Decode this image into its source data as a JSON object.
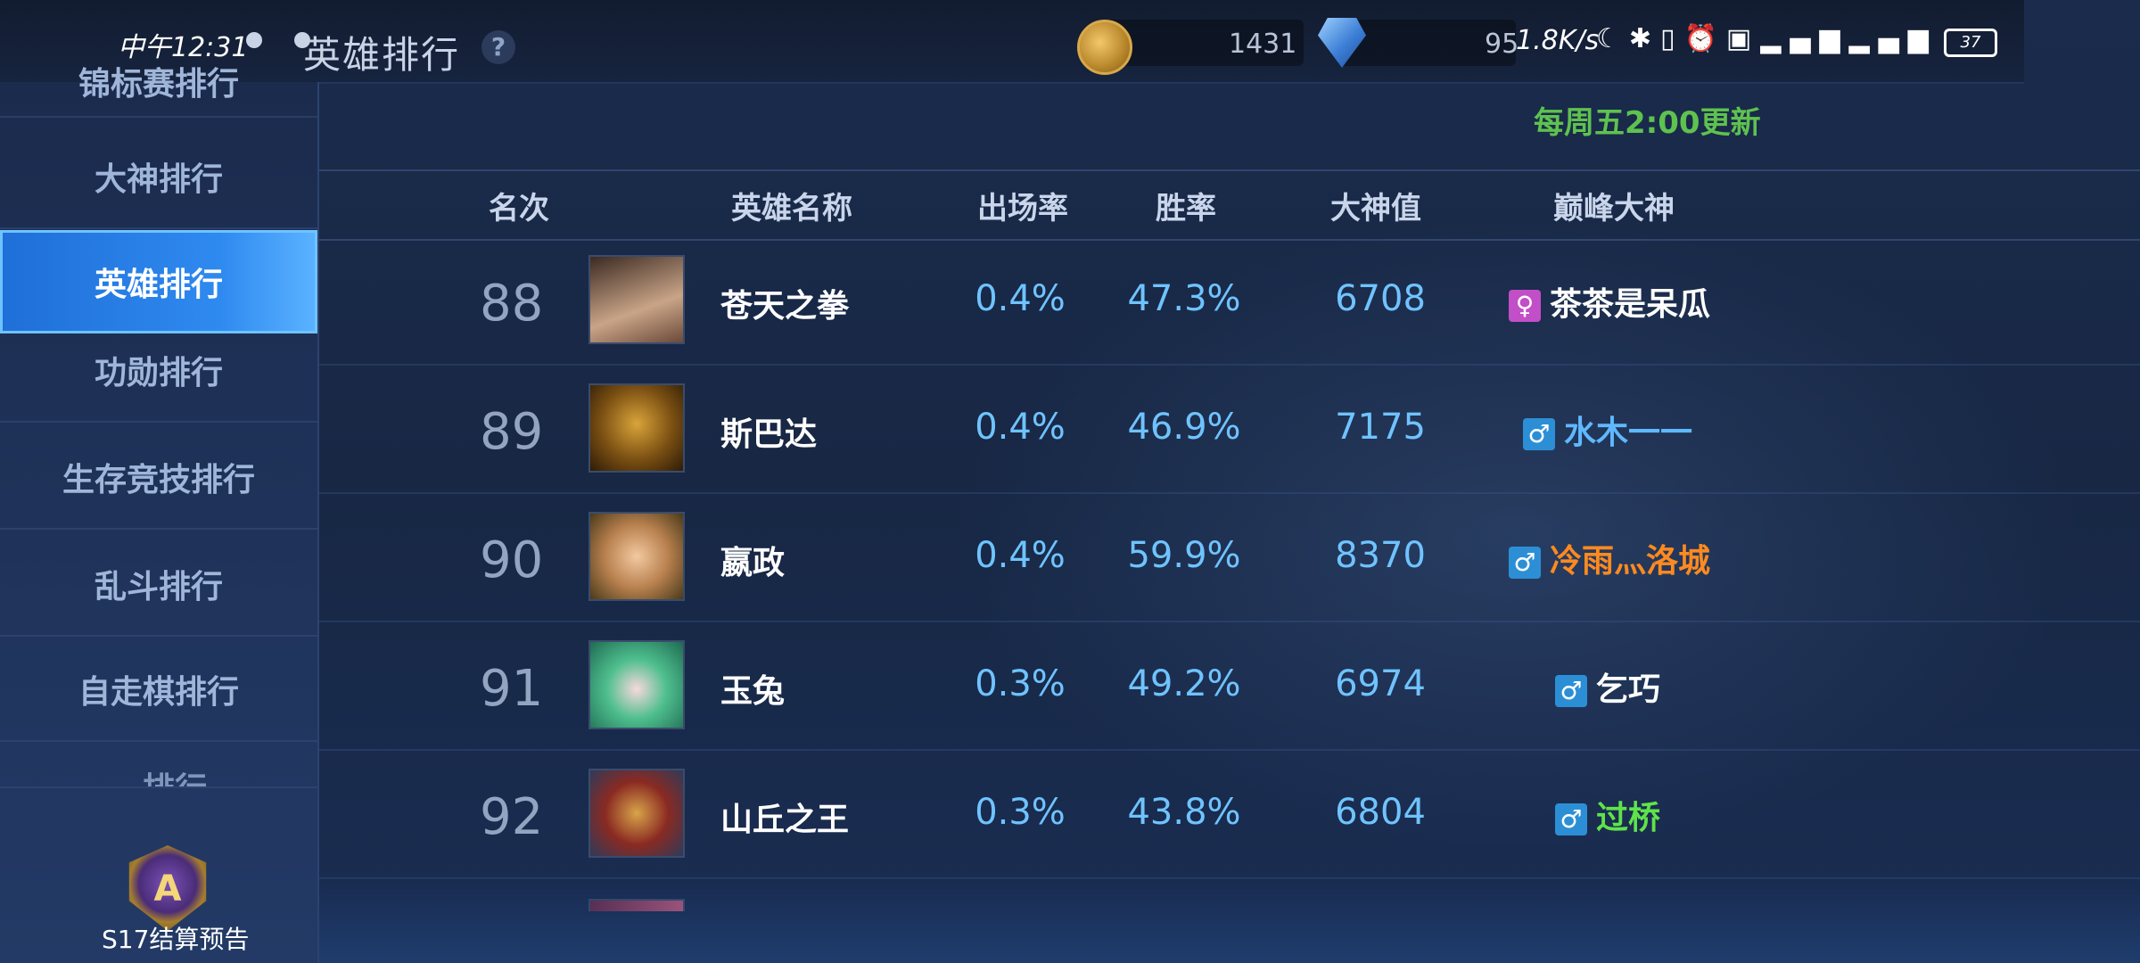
{
  "status_bar": {
    "time": "中午12:31",
    "net_speed": "1.8K/s",
    "battery": "37",
    "icons": [
      "moon-icon",
      "bluetooth-icon",
      "vibrate-icon",
      "alarm-icon",
      "hd-icon",
      "signal-icon",
      "signal-icon-2"
    ]
  },
  "header": {
    "title": "英雄排行",
    "help_label": "?",
    "coins": "1431",
    "diamonds": "95"
  },
  "sidebar": {
    "items": [
      {
        "label": "锦标赛排行"
      },
      {
        "label": "大神排行"
      },
      {
        "label": "英雄排行"
      },
      {
        "label": "功勋排行"
      },
      {
        "label": "生存竞技排行"
      },
      {
        "label": "乱斗排行"
      },
      {
        "label": "自走棋排行"
      },
      {
        "label": "…排行"
      }
    ],
    "season_label": "S17结算预告"
  },
  "main": {
    "update_note": "每周五2:00更新",
    "columns": {
      "rank": "名次",
      "hero": "英雄名称",
      "appearance": "出场率",
      "winrate": "胜率",
      "god_value": "大神值",
      "top_player": "巅峰大神"
    },
    "rows": [
      {
        "rank": "88",
        "hero": "苍天之拳",
        "appearance": "0.4%",
        "winrate": "47.3%",
        "god_value": "6708",
        "gender": "♀",
        "player": "茶茶是呆瓜",
        "player_color": "#ffffff"
      },
      {
        "rank": "89",
        "hero": "斯巴达",
        "appearance": "0.4%",
        "winrate": "46.9%",
        "god_value": "7175",
        "gender": "♂",
        "player": "水木一一",
        "player_color": "#5fb8ff"
      },
      {
        "rank": "90",
        "hero": "嬴政",
        "appearance": "0.4%",
        "winrate": "59.9%",
        "god_value": "8370",
        "gender": "♂",
        "player": "冷雨灬洛城",
        "player_color": "#ff8a1f"
      },
      {
        "rank": "91",
        "hero": "玉兔",
        "appearance": "0.3%",
        "winrate": "49.2%",
        "god_value": "6974",
        "gender": "♂",
        "player": "乞巧",
        "player_color": "#ffffff"
      },
      {
        "rank": "92",
        "hero": "山丘之王",
        "appearance": "0.3%",
        "winrate": "43.8%",
        "god_value": "6804",
        "gender": "♂",
        "player": "过桥",
        "player_color": "#5fe34a"
      }
    ]
  },
  "colors": {
    "accent": "#2f8af0",
    "value_blue": "#6fc3ff",
    "update_green": "#5ec24f"
  }
}
